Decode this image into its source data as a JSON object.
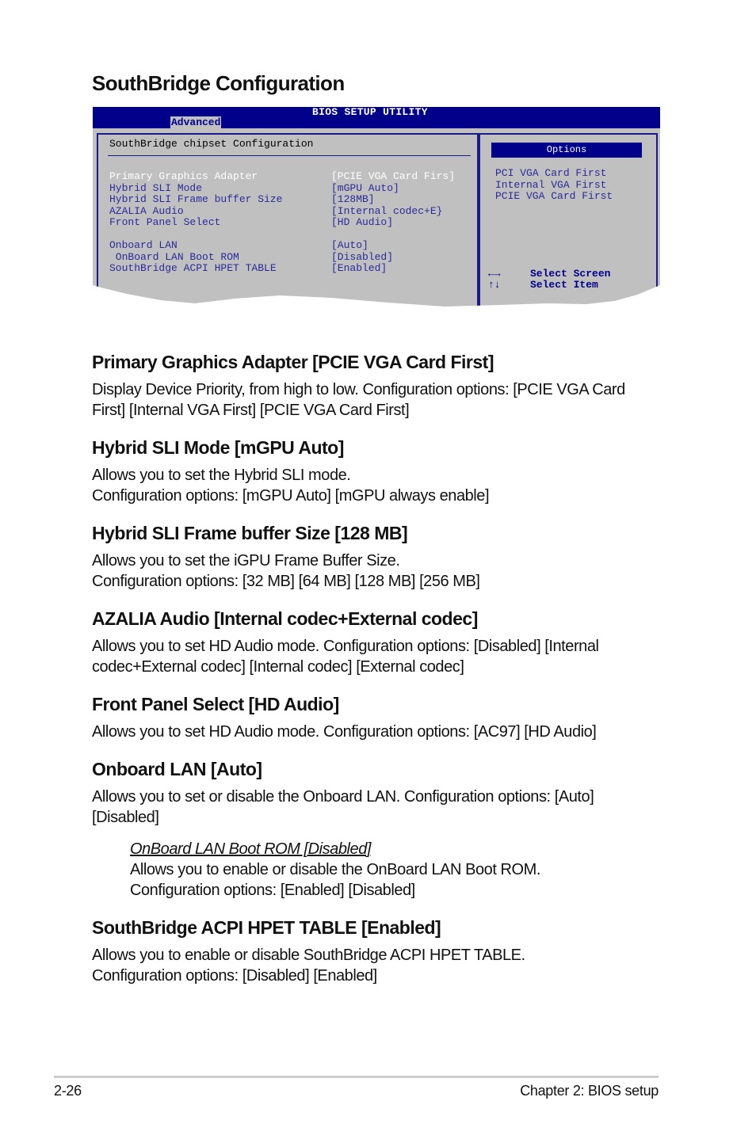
{
  "page_title": "SouthBridge Configuration",
  "bios": {
    "title": "BIOS SETUP UTILITY",
    "active_tab": "Advanced",
    "panel_title": "SouthBridge chipset Configuration",
    "items": [
      {
        "label": "Primary Graphics Adapter",
        "value": "[PCIE VGA Card Firs]",
        "selected": true
      },
      {
        "label": "Hybrid SLI Mode",
        "value": "[mGPU Auto]"
      },
      {
        "label": "Hybrid SLI Frame buffer Size",
        "value": "[128MB]"
      },
      {
        "label": "AZALIA Audio",
        "value": "[Internal codec+E}"
      },
      {
        "label": "Front Panel Select",
        "value": "[HD Audio]"
      },
      {
        "label": "Onboard LAN",
        "value": "[Auto]"
      },
      {
        "label": " OnBoard LAN Boot ROM",
        "value": "[Disabled]"
      },
      {
        "label": "SouthBridge ACPI HPET TABLE",
        "value": "[Enabled]"
      }
    ],
    "options_title": "Options",
    "options": [
      "PCI VGA Card First",
      "Internal VGA First",
      "PCIE VGA Card First"
    ],
    "keys": [
      {
        "key": "←→",
        "label": "Select Screen"
      },
      {
        "key": "↑↓",
        "label": "Select Item"
      }
    ],
    "colors": {
      "bar": "#00008b",
      "panel": "#c0c0c0",
      "text": "#2a2a9a"
    }
  },
  "sections": [
    {
      "title": "Primary Graphics Adapter [PCIE VGA Card First]",
      "lines": [
        "Display Device Priority, from high to low. Configuration options: [PCIE VGA Card",
        "First] [Internal VGA First] [PCIE VGA Card First]"
      ]
    },
    {
      "title": "Hybrid SLI Mode [mGPU Auto]",
      "lines": [
        "Allows you to set the Hybrid SLI mode.",
        "Configuration options: [mGPU Auto] [mGPU always enable]"
      ]
    },
    {
      "title": "Hybrid SLI Frame buffer Size [128 MB]",
      "lines": [
        "Allows you to set the iGPU Frame Buffer Size.",
        "Configuration options: [32 MB] [64 MB] [128 MB] [256 MB]"
      ]
    },
    {
      "title": "AZALIA Audio [Internal codec+External codec]",
      "lines": [
        "Allows you to set HD Audio mode. Configuration options: [Disabled] [Internal",
        "codec+External codec] [Internal codec] [External codec]"
      ]
    },
    {
      "title": "Front Panel Select [HD Audio]",
      "lines": [
        "Allows you to set HD Audio mode. Configuration options: [AC97] [HD Audio]"
      ]
    },
    {
      "title": "Onboard LAN [Auto]",
      "lines": [
        "Allows you to set or disable the Onboard LAN. Configuration options: [Auto]",
        "[Disabled]"
      ]
    },
    {
      "title": "SouthBridge ACPI HPET TABLE [Enabled]",
      "lines": [
        "Allows you to enable or disable SouthBridge ACPI HPET TABLE.",
        "Configuration options: [Disabled] [Enabled]"
      ]
    }
  ],
  "subsection": {
    "title": "OnBoard LAN Boot ROM [Disabled]",
    "lines": [
      "Allows you to enable or disable the OnBoard LAN Boot ROM.",
      "Configuration options: [Enabled] [Disabled]"
    ]
  },
  "footer": {
    "page_number": "2-26",
    "chapter": "Chapter 2: BIOS setup"
  }
}
